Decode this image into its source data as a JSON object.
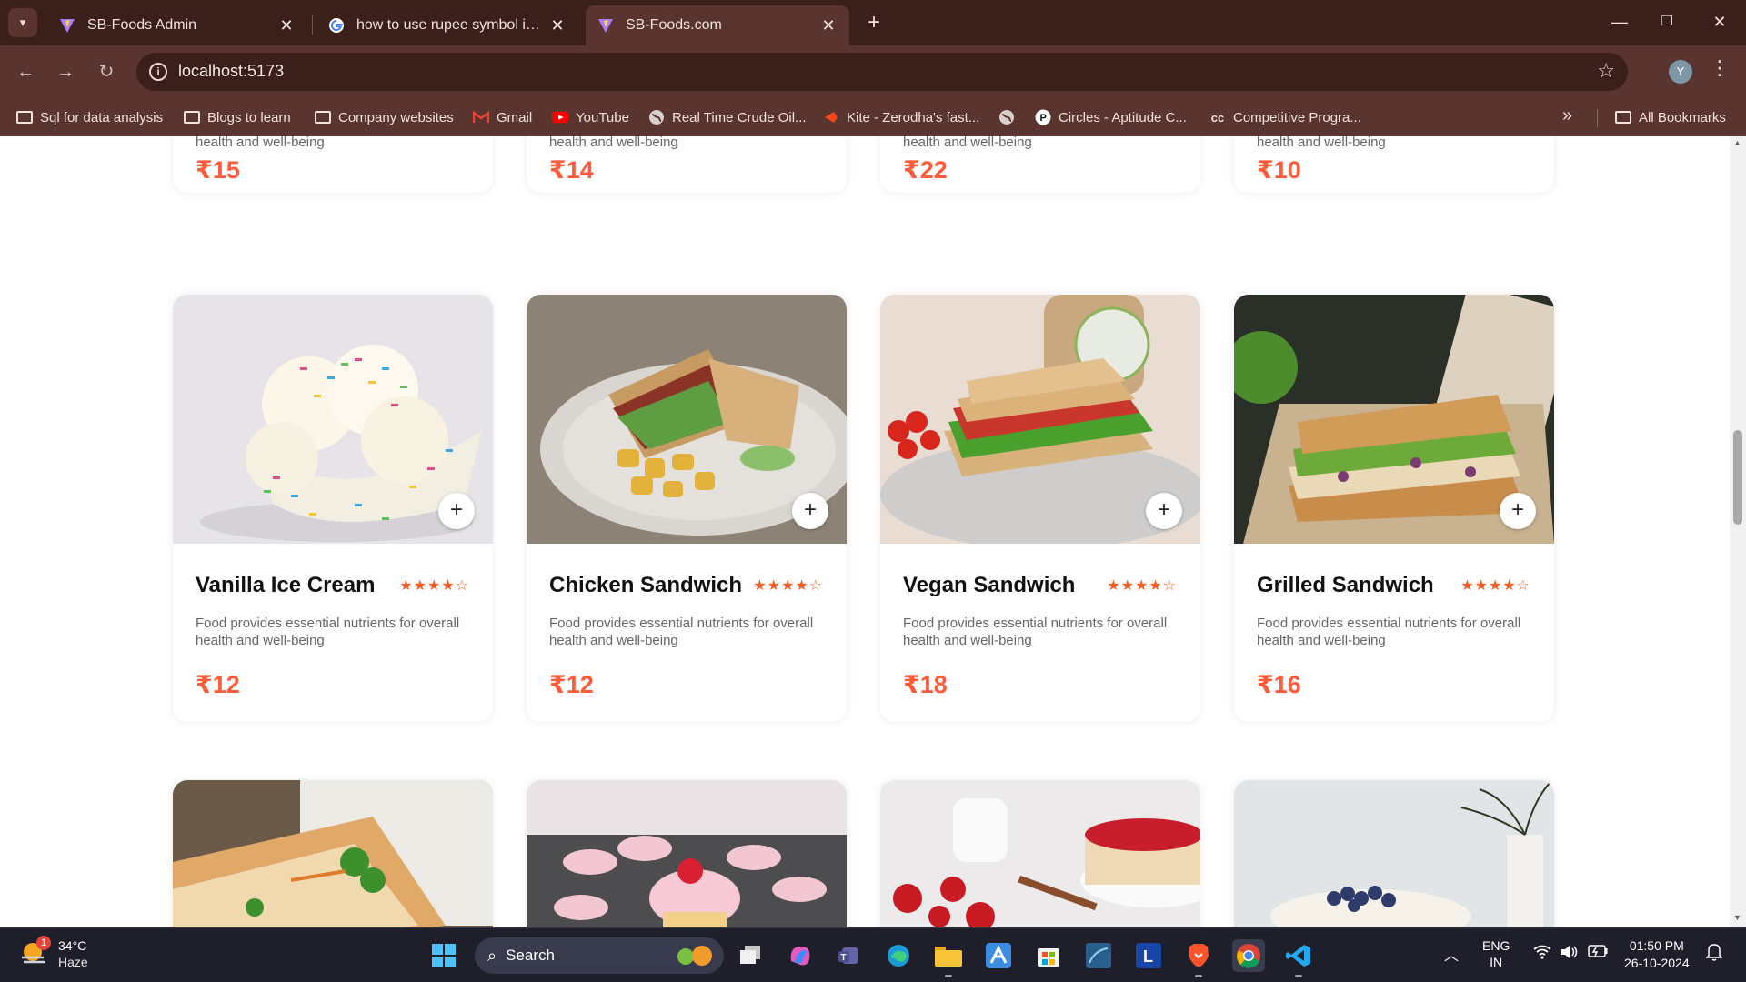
{
  "browser": {
    "tabs": [
      {
        "title": "SB-Foods Admin",
        "icon": "vite-logo-icon",
        "active": false
      },
      {
        "title": "how to use rupee symbol in key",
        "icon": "google-logo-icon",
        "active": false
      },
      {
        "title": "SB-Foods.com",
        "icon": "vite-logo-icon",
        "active": true
      }
    ],
    "url": "localhost:5173",
    "profile_initial": "Y",
    "bookmarks": [
      {
        "label": "Sql for data analysis",
        "icon": "folder-icon"
      },
      {
        "label": "Blogs to learn",
        "icon": "folder-icon"
      },
      {
        "label": "Company websites",
        "icon": "folder-icon"
      },
      {
        "label": "Gmail",
        "icon": "gmail-icon"
      },
      {
        "label": "YouTube",
        "icon": "youtube-icon"
      },
      {
        "label": "Real Time Crude Oil...",
        "icon": "globe-icon"
      },
      {
        "label": "Kite - Zerodha's fast...",
        "icon": "kite-icon"
      },
      {
        "label": "",
        "icon": "globe-icon"
      },
      {
        "label": "Circles - Aptitude C...",
        "icon": "circles-icon"
      },
      {
        "label": "Competitive Progra...",
        "icon": "cc-icon"
      }
    ],
    "all_bookmarks": "All Bookmarks"
  },
  "menu": {
    "top_row": [
      {
        "desc": "Food provides essential nutrients for overall health and well-being",
        "price": "₹15"
      },
      {
        "desc": "Food provides essential nutrients for overall health and well-being",
        "price": "₹14"
      },
      {
        "desc": "Food provides essential nutrients for overall health and well-being",
        "price": "₹22"
      },
      {
        "desc": "Food provides essential nutrients for overall health and well-being",
        "price": "₹10"
      }
    ],
    "items": [
      {
        "name": "Vanilla Ice Cream",
        "desc": "Food provides essential nutrients for overall health and well-being",
        "price": "₹12",
        "rating": 4
      },
      {
        "name": "Chicken Sandwich",
        "desc": "Food provides essential nutrients for overall health and well-being",
        "price": "₹12",
        "rating": 4
      },
      {
        "name": "Vegan Sandwich",
        "desc": "Food provides essential nutrients for overall health and well-being",
        "price": "₹18",
        "rating": 4
      },
      {
        "name": "Grilled Sandwich",
        "desc": "Food provides essential nutrients for overall health and well-being",
        "price": "₹16",
        "rating": 4
      }
    ],
    "add_label": "+",
    "stars_filled": "★★★★",
    "stars_empty": "☆"
  },
  "taskbar": {
    "weather_temp": "34°C",
    "weather_cond": "Haze",
    "weather_badge": "1",
    "search_label": "Search",
    "lang_top": "ENG",
    "lang_bottom": "IN",
    "time": "01:50 PM",
    "date": "26-10-2024"
  },
  "colors": {
    "chrome_dark": "#3b1f1a",
    "chrome_mid": "#5a342e",
    "price": "#ff5a3a",
    "stars": "#ff5a1f"
  }
}
